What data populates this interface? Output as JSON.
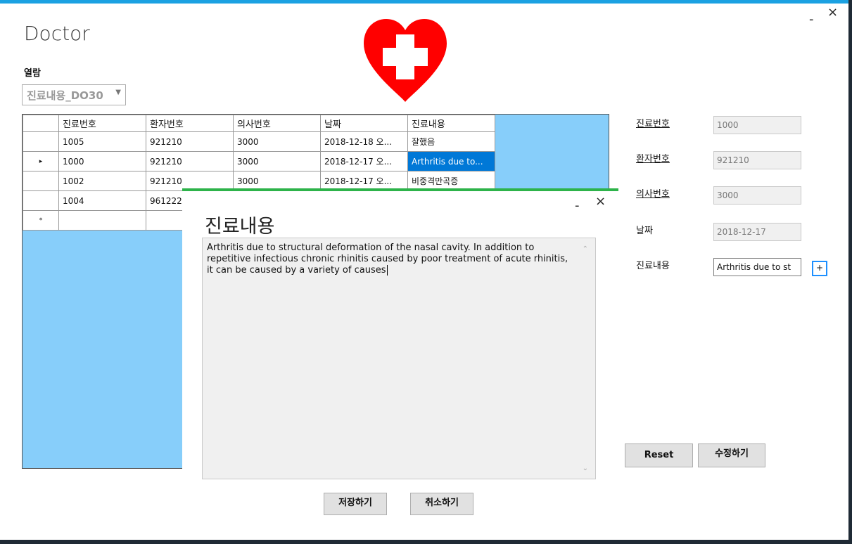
{
  "window": {
    "title": "Doctor",
    "minimize": "-",
    "close": "×"
  },
  "view": {
    "label": "열람",
    "combo_value": "진료내용_DO30"
  },
  "icons": {
    "combo_arrow": "dropdown-arrow-icon",
    "logo": "heart-cross-icon",
    "row_selector": "row-pointer-icon",
    "new_row": "new-row-asterisk-icon"
  },
  "colors": {
    "accent": "#1ba1e2",
    "grid_bg": "#87cefa",
    "heart": "#ff0000",
    "selection": "#0078d7",
    "dialog_accent": "#2db34a"
  },
  "grid": {
    "columns": [
      "진료번호",
      "환자번호",
      "의사번호",
      "날짜",
      "진료내용"
    ],
    "rows": [
      {
        "indicator": "",
        "cells": [
          "1005",
          "921210",
          "3000",
          "2018-12-18 오...",
          "잘했음"
        ]
      },
      {
        "indicator": "▸",
        "cells": [
          "1000",
          "921210",
          "3000",
          "2018-12-17 오...",
          "Arthritis due to..."
        ]
      },
      {
        "indicator": "",
        "cells": [
          "1002",
          "921210",
          "3000",
          "2018-12-17 오...",
          "비중격만곡증"
        ]
      },
      {
        "indicator": "",
        "cells": [
          "1004",
          "961222",
          "",
          "",
          ""
        ]
      },
      {
        "indicator": "*",
        "cells": [
          "",
          "",
          "",
          "",
          ""
        ]
      }
    ]
  },
  "form": {
    "fields": [
      {
        "label": "진료번호",
        "value": "1000"
      },
      {
        "label": "환자번호",
        "value": "921210"
      },
      {
        "label": "의사번호",
        "value": "3000"
      },
      {
        "label": "날짜",
        "value": "2018-12-17"
      },
      {
        "label": "진료내용",
        "value": "Arthritis due to st"
      }
    ],
    "plus_label": "+",
    "reset_label": "Reset",
    "edit_label": "수정하기"
  },
  "dialog": {
    "title": "진료내용",
    "minimize": "-",
    "close": "×",
    "text": "Arthritis due to structural deformation of the nasal cavity. In addition to repetitive infectious chronic rhinitis caused by poor treatment of acute rhinitis, it can be caused by a variety of causes",
    "save_label": "저장하기",
    "cancel_label": "취소하기"
  }
}
